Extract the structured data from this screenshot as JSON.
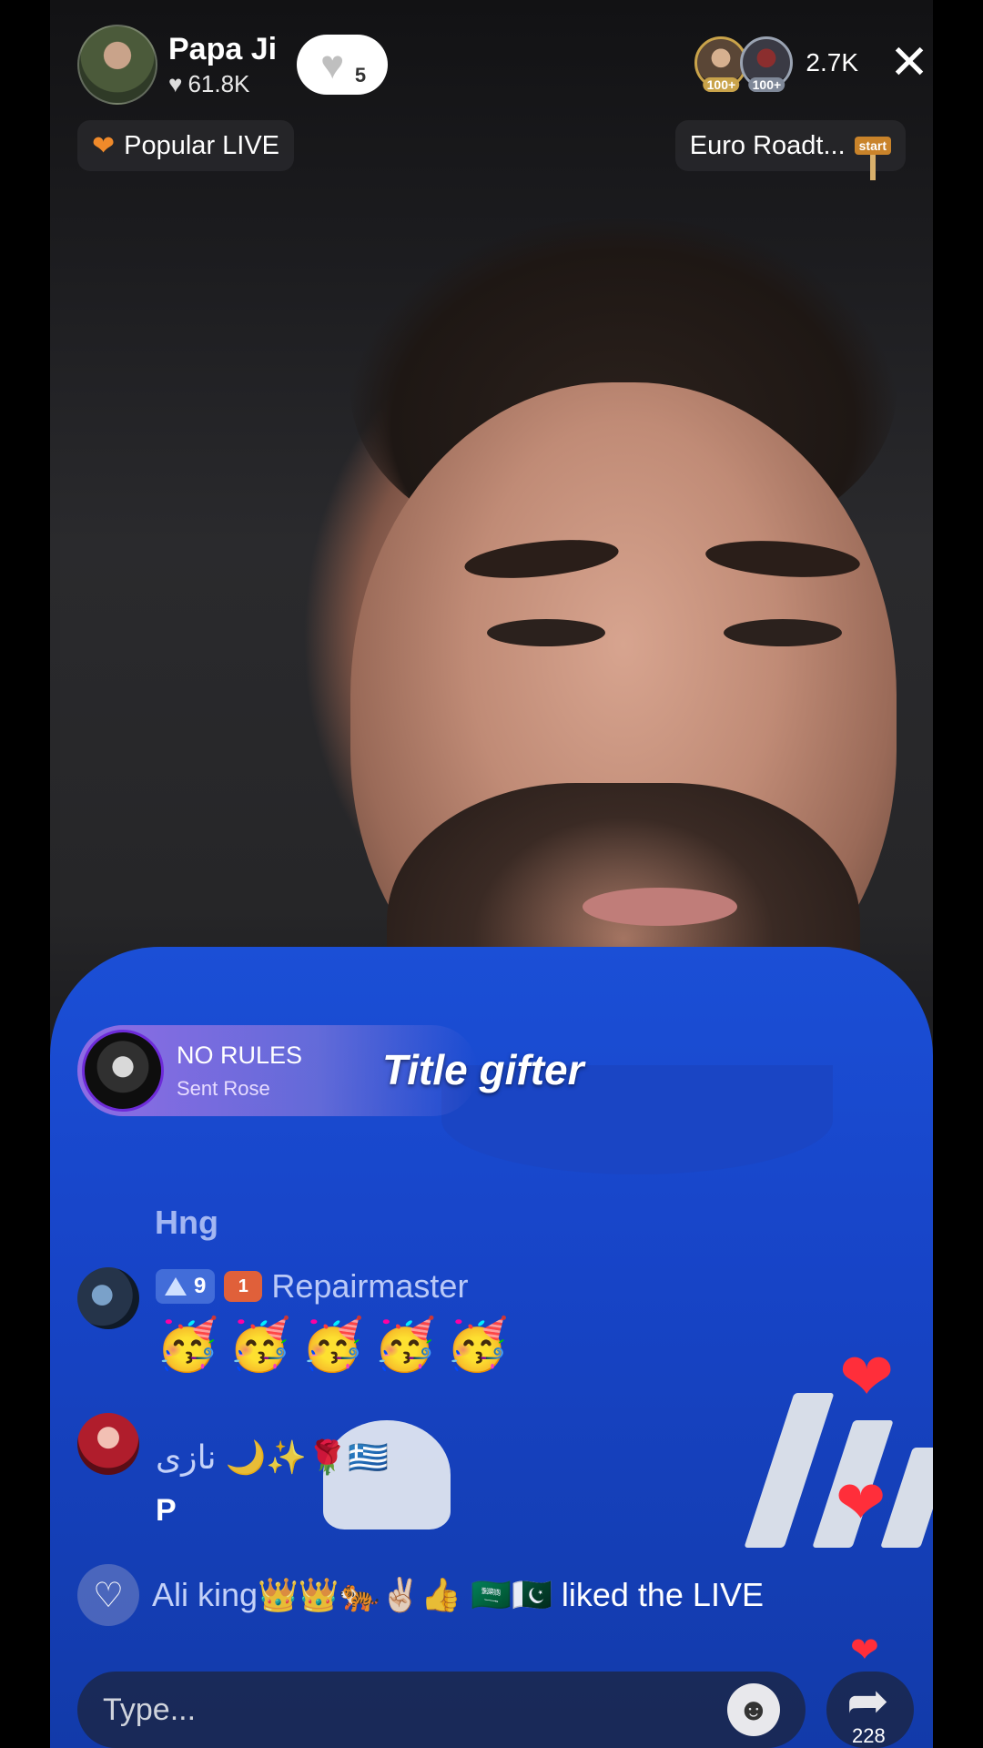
{
  "host": {
    "name": "Papa Ji",
    "likes": "61.8K",
    "follow_count": "5"
  },
  "viewers": {
    "badges": [
      "100+",
      "100+"
    ],
    "count": "2.7K"
  },
  "chips": {
    "left_label": "Popular LIVE",
    "right_label": "Euro Roadt...",
    "signpost_text": "start"
  },
  "gift": {
    "user": "NO RULES",
    "action": "Sent Rose",
    "title": "Title gifter"
  },
  "comments": [
    {
      "text": "Hng"
    },
    {
      "level": "9",
      "fan_badge": "1",
      "user": "Repairmaster",
      "message": "🥳🥳🥳🥳🥳"
    },
    {
      "user": "نازی 🌙✨🌹🇬🇷",
      "message": "P"
    }
  ],
  "liked": {
    "user": "Ali king👑👑🐅✌🏻👍 🇸🇦🇵🇰",
    "suffix": "liked the LIVE"
  },
  "input": {
    "placeholder": "Type..."
  },
  "share": {
    "count": "228"
  },
  "colors": {
    "accent_red": "#ff2e3a",
    "gift_purple": "#9a6ee6",
    "shirt_blue": "#1b4fd6"
  }
}
